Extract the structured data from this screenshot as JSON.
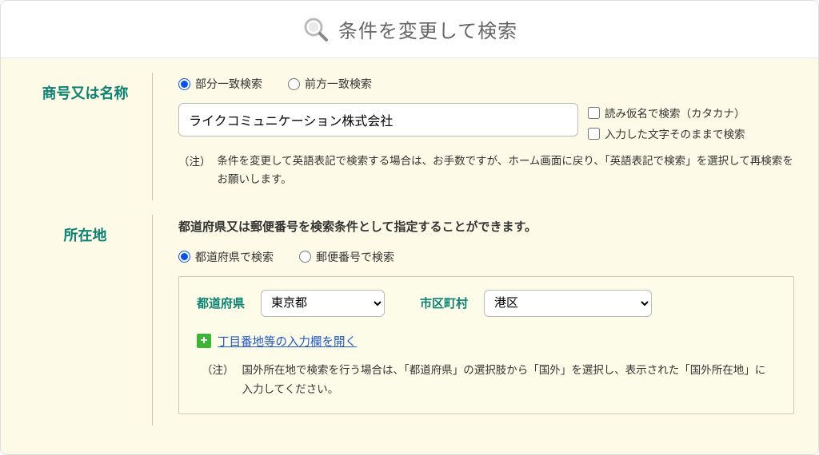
{
  "header": {
    "title": "条件を変更して検索"
  },
  "sections": {
    "name": {
      "label": "商号又は名称",
      "radios": {
        "partial": "部分一致検索",
        "prefix": "前方一致検索"
      },
      "input_value": "ライクコミュニケーション株式会社",
      "checkboxes": {
        "kana": "読み仮名で検索（カタカナ）",
        "exact": "入力した文字そのままで検索"
      },
      "note_marker": "（注）",
      "note_text": "条件を変更して英語表記で検索する場合は、お手数ですが、ホーム画面に戻り、「英語表記で検索」を選択して再検索をお願いします。"
    },
    "location": {
      "label": "所在地",
      "intro": "都道府県又は郵便番号を検索条件として指定することができます。",
      "radios": {
        "pref": "都道府県で検索",
        "postal": "郵便番号で検索"
      },
      "pref_label": "都道府県",
      "pref_value": "東京都",
      "city_label": "市区町村",
      "city_value": "港区",
      "expand_link": "丁目番地等の入力欄を開く",
      "note_marker": "（注）",
      "note_text": "国外所在地で検索を行う場合は、「都道府県」の選択肢から「国外」を選択し、表示された「国外所在地」に入力してください。"
    }
  }
}
